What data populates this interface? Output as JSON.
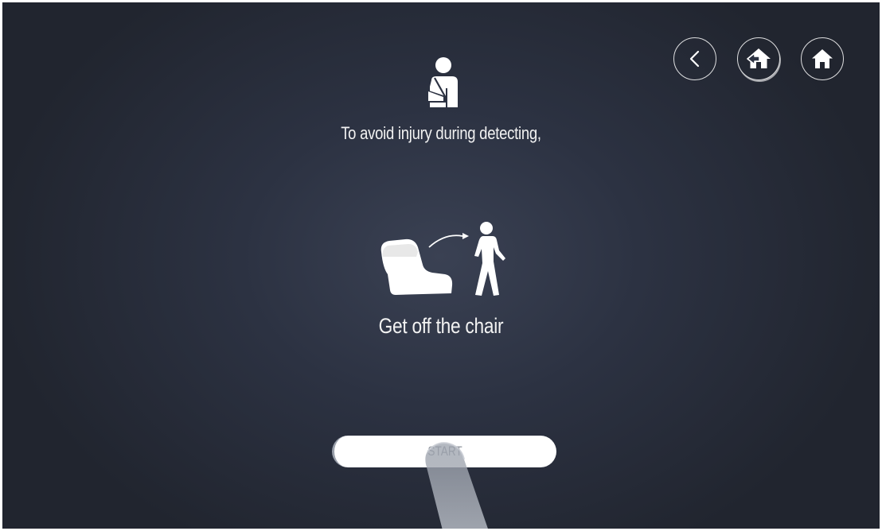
{
  "nav": {
    "back_icon": "chevron-left-icon",
    "return_icon": "home-return-icon",
    "home_icon": "home-icon"
  },
  "content": {
    "warning_icon": "injured-person-icon",
    "warning_text": "To avoid injury during detecting,",
    "instruction_icon": "leave-chair-icon",
    "instruction_text": "Get off the chair"
  },
  "start_button": {
    "label": "START"
  },
  "colors": {
    "background": "#2c3242",
    "foreground": "#ffffff",
    "button_text": "#8f949c"
  }
}
